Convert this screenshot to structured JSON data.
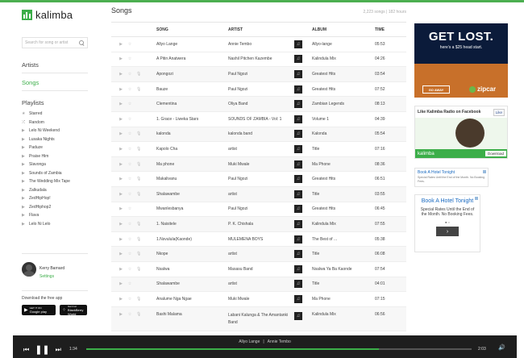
{
  "app": {
    "name": "kalimba"
  },
  "search": {
    "placeholder": "Search for song or artist"
  },
  "nav": {
    "artists": "Artists",
    "songs": "Songs",
    "playlists": "Playlists"
  },
  "playlists": [
    {
      "icon": "star-icon",
      "glyph": "★",
      "label": "Starred"
    },
    {
      "icon": "shuffle-icon",
      "glyph": "⤮",
      "label": "Random"
    },
    {
      "icon": "play-icon",
      "glyph": "▶",
      "label": "Lelo Ni Weekend"
    },
    {
      "icon": "play-icon",
      "glyph": "▶",
      "label": "Lusaka Nights"
    },
    {
      "icon": "play-icon",
      "glyph": "▶",
      "label": "Paduze"
    },
    {
      "icon": "play-icon",
      "glyph": "▶",
      "label": "Praise Him"
    },
    {
      "icon": "play-icon",
      "glyph": "▶",
      "label": "Slavonga"
    },
    {
      "icon": "play-icon",
      "glyph": "▶",
      "label": "Sounds of Zambia"
    },
    {
      "icon": "play-icon",
      "glyph": "▶",
      "label": "The Wedding Mix Tape"
    },
    {
      "icon": "play-icon",
      "glyph": "▶",
      "label": "Zalkudala"
    },
    {
      "icon": "play-icon",
      "glyph": "▶",
      "label": "ZedHipHop!"
    },
    {
      "icon": "play-icon",
      "glyph": "▶",
      "label": "ZedHiphop2"
    },
    {
      "icon": "play-icon",
      "glyph": "▶",
      "label": "Flava"
    },
    {
      "icon": "play-icon",
      "glyph": "▶",
      "label": "Lelo Ni Lelo"
    }
  ],
  "user": {
    "name": "Kerry Barnard",
    "settings": "Settings"
  },
  "download": {
    "label": "Download the free app",
    "google_top": "GET IT ON",
    "google_label": "Google play",
    "bb_top": "Get it at",
    "bb_label": "BlackBerry World"
  },
  "songs_page": {
    "title": "Songs",
    "meta": "2,223 songs | 182 hours"
  },
  "columns": {
    "song": "SONG",
    "artist": "ARTIST",
    "album": "ALBUM",
    "time": "TIME"
  },
  "rows": [
    {
      "song": "Allyo Lange",
      "artist": "Annie Tembo",
      "album": "Allyo-lange",
      "time": "05:53",
      "mic": false,
      "alt": false
    },
    {
      "song": "A Pitin Anatwera",
      "artist": "Nashil Pitchen Kazembe",
      "album": "Kalindula Mix",
      "time": "04:26",
      "mic": false,
      "alt": false
    },
    {
      "song": "Apongozi",
      "artist": "Paul Ngozi",
      "album": "Greatest Hits",
      "time": "03:54",
      "mic": true,
      "alt": true
    },
    {
      "song": "Bauze",
      "artist": "Paul Ngozi",
      "album": "Greatest Hits",
      "time": "07:52",
      "mic": true,
      "alt": false
    },
    {
      "song": "Clementina",
      "artist": "Oliya Band",
      "album": "Zambian Legends",
      "time": "08:13",
      "mic": false,
      "alt": true
    },
    {
      "song": "1. Grace - Liweka Stars",
      "artist": "SOUNDS OF ZAMBIA - Vol: 1",
      "album": "Volume 1",
      "time": "04:39",
      "mic": false,
      "alt": false
    },
    {
      "song": "kalonda",
      "artist": "kalonda band",
      "album": "Kalonda",
      "time": "05:54",
      "mic": true,
      "alt": true
    },
    {
      "song": "Kapolo Cha",
      "artist": "artist",
      "album": "Title",
      "time": "07:16",
      "mic": true,
      "alt": false
    },
    {
      "song": "Ma phone",
      "artist": "Muki Mwale",
      "album": "Ma Phone",
      "time": "08:36",
      "mic": true,
      "alt": true
    },
    {
      "song": "Makalivanu",
      "artist": "Paul Ngozi",
      "album": "Greatest Hits",
      "time": "06:51",
      "mic": true,
      "alt": false
    },
    {
      "song": "Shalawambe",
      "artist": "artist",
      "album": "Title",
      "time": "03:55",
      "mic": true,
      "alt": true
    },
    {
      "song": "Mwanlesbanya",
      "artist": "Paul Ngozi",
      "album": "Greatest Hits",
      "time": "06:45",
      "mic": false,
      "alt": false
    },
    {
      "song": "1. Naisitele",
      "artist": "P. K. Chishala",
      "album": "Kalindula Mix",
      "time": "07:55",
      "mic": true,
      "alt": true
    },
    {
      "song": "1.Nsvulula(Kaonde)",
      "artist": "MULEMENA BOYS",
      "album": "The Best of ...",
      "time": "05:38",
      "mic": true,
      "alt": false
    },
    {
      "song": "Nkope",
      "artist": "artist",
      "album": "Title",
      "time": "06:08",
      "mic": true,
      "alt": true
    },
    {
      "song": "Nsalwa",
      "artist": "Masasu Band",
      "album": "Nsalwa Ya Ba Kaonde",
      "time": "07:54",
      "mic": true,
      "alt": false
    },
    {
      "song": "Shalawambe",
      "artist": "artist",
      "album": "Title",
      "time": "04:01",
      "mic": false,
      "alt": true
    },
    {
      "song": "Analume Nga Ngae",
      "artist": "Muki Mwale",
      "album": "Ma Phone",
      "time": "07:15",
      "mic": true,
      "alt": false
    },
    {
      "song": "Bashi Malama",
      "artist": "Labani Kalunga & The Amantanki Band",
      "album": "Kalindula Mix",
      "time": "06:56",
      "mic": true,
      "alt": true,
      "tall": true
    }
  ],
  "ads": {
    "zipcar": {
      "headline": "GET LOST.",
      "sub": "here's a $25 head start.",
      "cta": "GO AWAY",
      "brand": "zipcar"
    },
    "kalimba_fb": {
      "text": "Like Kalimba Radio on Facebook",
      "like": "Like",
      "brand": "kalimba",
      "download": "Download"
    },
    "hotel_small": {
      "title": "Book A Hotel Tonight",
      "body": "Special Rates Until the End of the Month. No Booking Fees."
    },
    "hotel_big": {
      "title": "Book A Hotel Tonight",
      "body": "Special Rates Until the End of the Month. No Booking Fees.",
      "next": "›"
    }
  },
  "player": {
    "title": "Allyo Lange",
    "artist": "Annie Tembo",
    "elapsed": "1:34",
    "total": "2:03",
    "progress_fraction": 0.76
  }
}
